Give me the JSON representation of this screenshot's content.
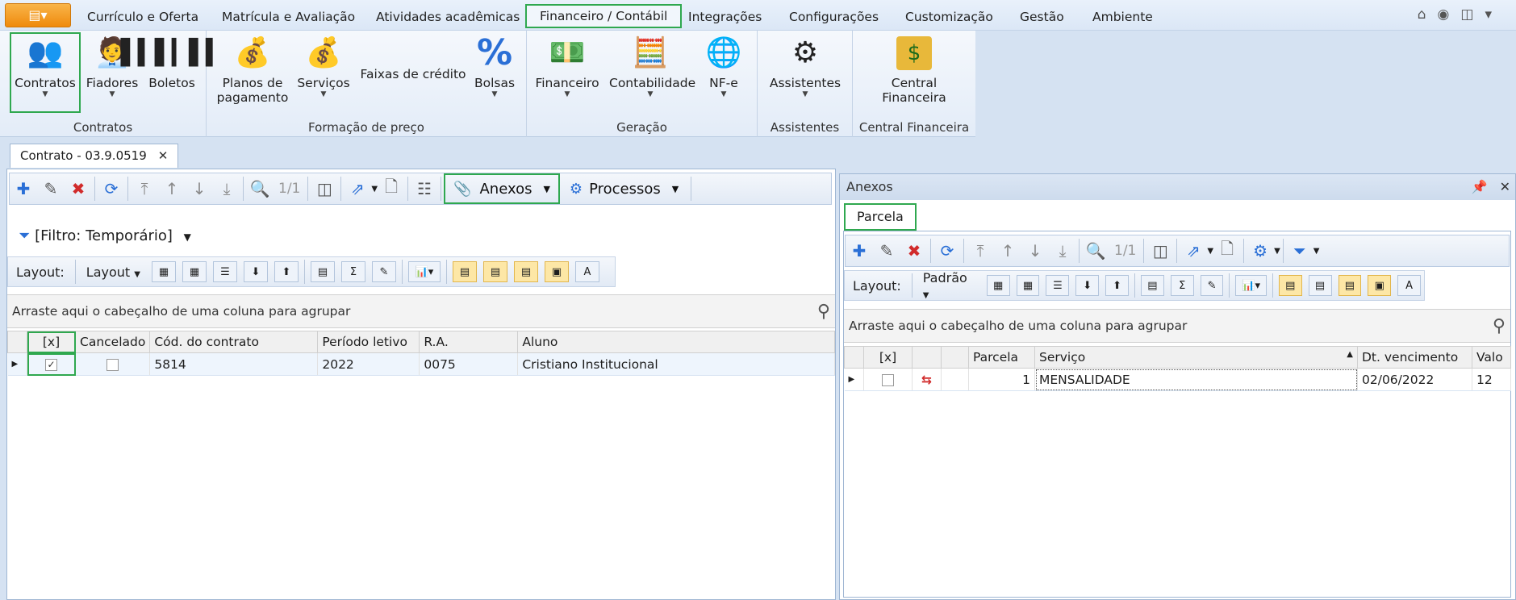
{
  "menubar": {
    "app_icon": "app-menu-icon",
    "tabs": [
      "Currículo e Oferta",
      "Matrícula e Avaliação",
      "Atividades acadêmicas",
      "Financeiro / Contábil",
      "Integrações",
      "Configurações",
      "Customização",
      "Gestão",
      "Ambiente"
    ],
    "active_tab": "Financeiro / Contábil"
  },
  "ribbon": {
    "groups": [
      {
        "label": "Contratos",
        "buttons": [
          "Contratos",
          "Fiadores",
          "Boletos"
        ]
      },
      {
        "label": "Formação de preço",
        "buttons": [
          "Planos de pagamento",
          "Serviços",
          "Faixas de crédito",
          "Bolsas"
        ]
      },
      {
        "label": "Geração",
        "buttons": [
          "Financeiro",
          "Contabilidade",
          "NF-e"
        ]
      },
      {
        "label": "Assistentes",
        "buttons": [
          "Assistentes"
        ]
      },
      {
        "label": "Central Financeira",
        "buttons": [
          "Central Financeira"
        ]
      }
    ]
  },
  "doc_tab": {
    "title": "Contrato - 03.9.0519"
  },
  "left": {
    "page_counter": "1/1",
    "anexos_label": "Anexos",
    "processos_label": "Processos",
    "filter_label": "[Filtro: Temporário]",
    "layout_label": "Layout:",
    "layout_dropdown": "Layout",
    "group_hint": "Arraste aqui o cabeçalho de uma coluna para agrupar",
    "columns": [
      "[x]",
      "Cancelado",
      "Cód. do contrato",
      "Período letivo",
      "R.A.",
      "Aluno"
    ],
    "rows": [
      {
        "selected": true,
        "cancelado": false,
        "codigo": "5814",
        "periodo": "2022",
        "ra": "0075",
        "aluno": "Cristiano Institucional"
      }
    ]
  },
  "right": {
    "title": "Anexos",
    "tab": "Parcela",
    "page_counter": "1/1",
    "layout_label": "Layout:",
    "layout_dropdown": "Padrão",
    "group_hint": "Arraste aqui o cabeçalho de uma coluna para agrupar",
    "columns": [
      "[x]",
      "",
      "",
      "Parcela",
      "Serviço",
      "Dt. vencimento",
      "Valo"
    ],
    "rows": [
      {
        "parcela": "1",
        "servico": "MENSALIDADE",
        "vencimento": "02/06/2022",
        "valor": "12"
      }
    ]
  }
}
